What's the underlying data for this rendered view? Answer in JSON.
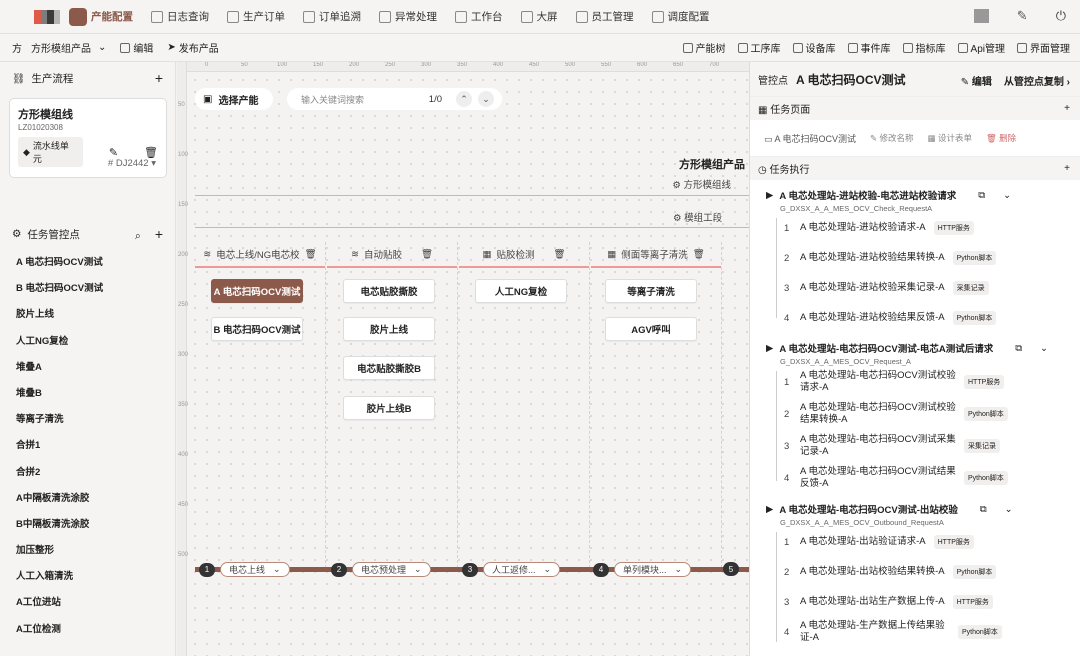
{
  "nav": {
    "items": [
      {
        "label": "产能配置",
        "active": true
      },
      {
        "label": "日志查询"
      },
      {
        "label": "生产订单"
      },
      {
        "label": "订单追溯"
      },
      {
        "label": "异常处理"
      },
      {
        "label": "工作台"
      },
      {
        "label": "大屏"
      },
      {
        "label": "员工管理"
      },
      {
        "label": "调度配置"
      }
    ]
  },
  "toolbar": {
    "product": "方形模组产品",
    "edit": "编辑",
    "publish": "发布产品",
    "right": [
      "产能树",
      "工序库",
      "设备库",
      "事件库",
      "指标库",
      "Api管理",
      "界面管理"
    ]
  },
  "left": {
    "flow_title": "生产流程",
    "card": {
      "name": "方形模组线",
      "code": "LZ01020308",
      "tag": "流水线单元",
      "id": "# DJ2442"
    },
    "tasks_title": "任务管控点",
    "tasks": [
      "A 电芯扫码OCV测试",
      "B 电芯扫码OCV测试",
      "胶片上线",
      "人工NG复检",
      "堆叠A",
      "堆叠B",
      "等离子清洗",
      "合拼1",
      "合拼2",
      "A中隔板清洗涂胶",
      "B中隔板清洗涂胶",
      "加压整形",
      "人工入箱清洗",
      "A工位进站",
      "A工位检测"
    ]
  },
  "canvas": {
    "select_label": "选择产能",
    "search_placeholder": "输入关键词搜索",
    "count": "1/0",
    "product_title": "方形模组产品",
    "product_sub": "方形模组线",
    "module_sub": "模组工段",
    "columns": [
      {
        "title": "电芯上线/NG电芯校",
        "nodes": [
          "A 电芯扫码OCV测试",
          "B 电芯扫码OCV测试"
        ]
      },
      {
        "title": "自动贴胶",
        "nodes": [
          "电芯贴胶撕胶",
          "胶片上线",
          "电芯贴胶撕胶B",
          "胶片上线B"
        ]
      },
      {
        "title": "贴胶检测",
        "nodes": [
          "人工NG复检"
        ]
      },
      {
        "title": "侧面等离子清洗",
        "nodes": [
          "等离子清洗",
          "AGV呼叫"
        ]
      }
    ],
    "stages": [
      {
        "num": "1",
        "label": "电芯上线"
      },
      {
        "num": "2",
        "label": "电芯预处理"
      },
      {
        "num": "3",
        "label": "人工返修..."
      },
      {
        "num": "4",
        "label": "单列模块..."
      },
      {
        "num": "5",
        "label": ""
      }
    ],
    "ruler_top": [
      "0",
      "50",
      "100",
      "150",
      "200",
      "250",
      "300",
      "350",
      "400",
      "450",
      "500",
      "550",
      "600",
      "650",
      "700"
    ],
    "ruler_left": [
      "50",
      "100",
      "150",
      "200",
      "250",
      "300",
      "350",
      "400",
      "450",
      "500"
    ]
  },
  "right": {
    "label": "管控点",
    "title": "A 电芯扫码OCV测试",
    "edit": "编辑",
    "copy": "从管控点复制",
    "page_section": "任务页面",
    "page": {
      "name": "A 电芯扫码OCV测试",
      "rename": "修改名称",
      "design": "设计表单",
      "delete": "删除"
    },
    "exec_section": "任务执行",
    "groups": [
      {
        "title": "A 电芯处理站-进站校验-电芯进站校验请求",
        "code": "G_DXSX_A_A_MES_OCV_Check_RequestA",
        "tasks": [
          {
            "n": "1",
            "text": "A 电芯处理站-进站校验请求-A",
            "badge": "HTTP服务"
          },
          {
            "n": "2",
            "text": "A 电芯处理站-进站校验结果转换-A",
            "badge": "Python脚本"
          },
          {
            "n": "3",
            "text": "A 电芯处理站-进站校验采集记录-A",
            "badge": "采集记录"
          },
          {
            "n": "4",
            "text": "A 电芯处理站-进站校验结果反馈-A",
            "badge": "Python脚本"
          }
        ]
      },
      {
        "title": "A 电芯处理站-电芯扫码OCV测试-电芯A测试后请求",
        "code": "G_DXSX_A_A_MES_OCV_Request_A",
        "tasks": [
          {
            "n": "1",
            "text": "A 电芯处理站-电芯扫码OCV测试校验请求-A",
            "badge": "HTTP服务"
          },
          {
            "n": "2",
            "text": "A 电芯处理站-电芯扫码OCV测试校验结果转换-A",
            "badge": "Python脚本"
          },
          {
            "n": "3",
            "text": "A 电芯处理站-电芯扫码OCV测试采集记录-A",
            "badge": "采集记录"
          },
          {
            "n": "4",
            "text": "A 电芯处理站-电芯扫码OCV测试结果反馈-A",
            "badge": "Python脚本"
          }
        ]
      },
      {
        "title": "A 电芯处理站-电芯扫码OCV测试-出站校验",
        "code": "G_DXSX_A_A_MES_OCV_Outbound_RequestA",
        "tasks": [
          {
            "n": "1",
            "text": "A 电芯处理站-出站验证请求-A",
            "badge": "HTTP服务"
          },
          {
            "n": "2",
            "text": "A 电芯处理站-出站校验结果转换-A",
            "badge": "Python脚本"
          },
          {
            "n": "3",
            "text": "A 电芯处理站-出站生产数据上传-A",
            "badge": "HTTP服务"
          },
          {
            "n": "4",
            "text": "A 电芯处理站-生产数据上传结果验证-A",
            "badge": "Python脚本"
          }
        ]
      }
    ]
  },
  "colors": {
    "accent": "#8b5a4a",
    "highlight": "#e99999"
  }
}
